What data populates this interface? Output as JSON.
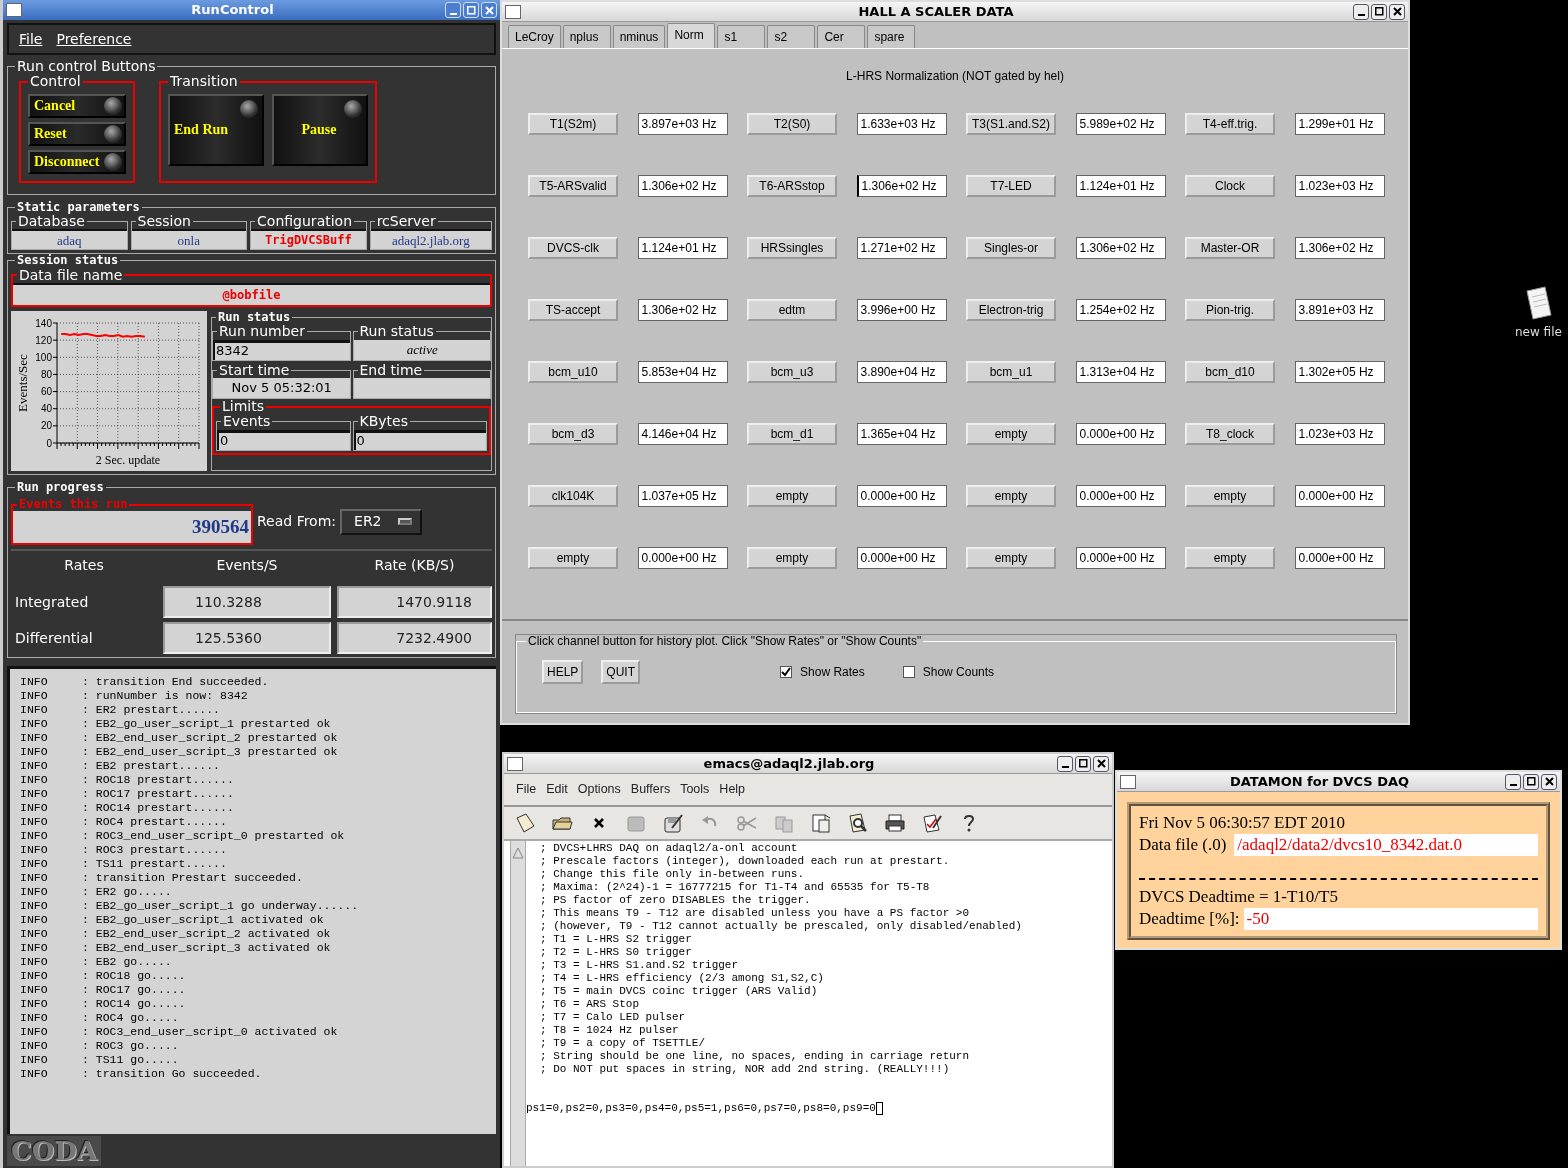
{
  "runcontrol": {
    "title": "RunControl",
    "menu": [
      "File",
      "Preference"
    ],
    "buttons_group": "Run control Buttons",
    "control": {
      "label": "Control",
      "buttons": [
        "Cancel",
        "Reset",
        "Disconnect"
      ]
    },
    "transition": {
      "label": "Transition",
      "buttons": [
        "End Run",
        "Pause"
      ]
    },
    "static": {
      "label": "Static parameters",
      "fields": [
        {
          "label": "Database",
          "value": "adaq",
          "highlight": false
        },
        {
          "label": "Session",
          "value": "onla",
          "highlight": false
        },
        {
          "label": "Configuration",
          "value": "TrigDVCSBuff",
          "highlight": true
        },
        {
          "label": "rcServer",
          "value": "adaql2.jlab.org",
          "highlight": false
        }
      ]
    },
    "session": {
      "label": "Session status",
      "data_file_label": "Data file name",
      "data_file": "@bobfile"
    },
    "chart_data": {
      "type": "line",
      "xlabel": "2 Sec. update",
      "ylabel": "Events/Sec",
      "ylim": [
        0,
        140
      ],
      "grid": true,
      "yticks": [
        0,
        20,
        40,
        60,
        80,
        100,
        120,
        140
      ],
      "categories": [
        null,
        null,
        null,
        null,
        null,
        null,
        null,
        null,
        null,
        null,
        null,
        null,
        null,
        null,
        null,
        null,
        null,
        null,
        null,
        null
      ],
      "series": [
        {
          "color": "#ff0000",
          "values": [
            127,
            127,
            126,
            127,
            126,
            127,
            127,
            126,
            125,
            125,
            126,
            125,
            125,
            126,
            124,
            125,
            124,
            125,
            125,
            124
          ]
        }
      ]
    },
    "run_status": {
      "label": "Run status",
      "fields": [
        {
          "label": "Run number",
          "value": "8342"
        },
        {
          "label": "Run status",
          "value": "active"
        },
        {
          "label": "Start time",
          "value": "Nov 5 05:32:01"
        },
        {
          "label": "End time"
        }
      ]
    },
    "limits": {
      "label": "Limits",
      "fields": [
        {
          "label": "Events",
          "value": "0"
        },
        {
          "label": "KBytes",
          "value": "0"
        }
      ]
    },
    "progress": {
      "label": "Run progress",
      "events_label": "Events this run",
      "events": "390564",
      "read_from_label": "Read From:",
      "read_from": "ER2"
    },
    "rates": {
      "columns": [
        "Rates",
        "Events/S",
        "Rate (KB/S)"
      ],
      "rows": [
        {
          "label": "Integrated",
          "values": [
            "110.3288",
            "1470.9118"
          ]
        },
        {
          "label": "Differential",
          "values": [
            "125.5360",
            "7232.4900"
          ]
        }
      ]
    },
    "log": [
      {
        "level": "INFO",
        "text": ": transition End succeeded."
      },
      {
        "level": "INFO",
        "text": ": runNumber is now: 8342"
      },
      {
        "level": "INFO",
        "text": ": ER2 prestart......"
      },
      {
        "level": "INFO",
        "text": ": EB2_go_user_script_1 prestarted ok"
      },
      {
        "level": "INFO",
        "text": ": EB2_end_user_script_2 prestarted ok"
      },
      {
        "level": "INFO",
        "text": ": EB2_end_user_script_3 prestarted ok"
      },
      {
        "level": "INFO",
        "text": ": EB2 prestart......"
      },
      {
        "level": "INFO",
        "text": ": ROC18 prestart......"
      },
      {
        "level": "INFO",
        "text": ": ROC17 prestart......"
      },
      {
        "level": "INFO",
        "text": ": ROC14 prestart......"
      },
      {
        "level": "INFO",
        "text": ": ROC4 prestart......"
      },
      {
        "level": "INFO",
        "text": ": ROC3_end_user_script_0 prestarted ok"
      },
      {
        "level": "INFO",
        "text": ": ROC3 prestart......"
      },
      {
        "level": "INFO",
        "text": ": TS11 prestart......"
      },
      {
        "level": "INFO",
        "text": ": transition Prestart succeeded."
      },
      {
        "level": "INFO",
        "text": ": ER2 go....."
      },
      {
        "level": "INFO",
        "text": ": EB2_go_user_script_1 go underway......"
      },
      {
        "level": "INFO",
        "text": ": EB2_go_user_script_1 activated ok"
      },
      {
        "level": "INFO",
        "text": ": EB2_end_user_script_2 activated ok"
      },
      {
        "level": "INFO",
        "text": ": EB2_end_user_script_3 activated ok"
      },
      {
        "level": "INFO",
        "text": ": EB2 go....."
      },
      {
        "level": "INFO",
        "text": ": ROC18 go....."
      },
      {
        "level": "INFO",
        "text": ": ROC17 go....."
      },
      {
        "level": "INFO",
        "text": ": ROC14 go....."
      },
      {
        "level": "INFO",
        "text": ": ROC4 go....."
      },
      {
        "level": "INFO",
        "text": ": ROC3_end_user_script_0 activated ok"
      },
      {
        "level": "INFO",
        "text": ": ROC3 go....."
      },
      {
        "level": "INFO",
        "text": ": TS11 go....."
      },
      {
        "level": "INFO",
        "text": ": transition Go succeeded."
      }
    ],
    "logo": "CODA"
  },
  "scaler": {
    "title": "HALL  A  SCALER  DATA",
    "tabs": [
      {
        "label": "LeCroy",
        "selected": false
      },
      {
        "label": "nplus",
        "selected": false
      },
      {
        "label": "nminus",
        "selected": false
      },
      {
        "label": "Norm",
        "selected": true
      },
      {
        "label": "s1",
        "selected": false
      },
      {
        "label": "s2",
        "selected": false
      },
      {
        "label": "Cer",
        "selected": false
      },
      {
        "label": "spare",
        "selected": false
      }
    ],
    "heading": "L-HRS Normalization (NOT gated by hel)",
    "channels": [
      {
        "name": "T1(S2m)",
        "rate": "3.897e+03 Hz"
      },
      {
        "name": "T2(S0)",
        "rate": "1.633e+03 Hz"
      },
      {
        "name": "T3(S1.and.S2)",
        "rate": "5.989e+02 Hz"
      },
      {
        "name": "T4-eff.trig.",
        "rate": "1.299e+01 Hz"
      },
      {
        "name": "T5-ARSvalid",
        "rate": "1.306e+02 Hz"
      },
      {
        "name": "T6-ARSstop",
        "rate": "1.306e+02 Hz",
        "focused": true
      },
      {
        "name": "T7-LED",
        "rate": "1.124e+01 Hz"
      },
      {
        "name": "Clock",
        "rate": "1.023e+03 Hz"
      },
      {
        "name": "DVCS-clk",
        "rate": "1.124e+01 Hz"
      },
      {
        "name": "HRSsingles",
        "rate": "1.271e+02 Hz"
      },
      {
        "name": "Singles-or",
        "rate": "1.306e+02 Hz"
      },
      {
        "name": "Master-OR",
        "rate": "1.306e+02 Hz"
      },
      {
        "name": "TS-accept",
        "rate": "1.306e+02 Hz"
      },
      {
        "name": "edtm",
        "rate": "3.996e+00 Hz"
      },
      {
        "name": "Electron-trig",
        "rate": "1.254e+02 Hz"
      },
      {
        "name": "Pion-trig.",
        "rate": "3.891e+03 Hz"
      },
      {
        "name": "bcm_u10",
        "rate": "5.853e+04 Hz"
      },
      {
        "name": "bcm_u3",
        "rate": "3.890e+04 Hz"
      },
      {
        "name": "bcm_u1",
        "rate": "1.313e+04 Hz"
      },
      {
        "name": "bcm_d10",
        "rate": "1.302e+05 Hz"
      },
      {
        "name": "bcm_d3",
        "rate": "4.146e+04 Hz"
      },
      {
        "name": "bcm_d1",
        "rate": "1.365e+04 Hz"
      },
      {
        "name": "empty",
        "rate": "0.000e+00 Hz"
      },
      {
        "name": "T8_clock",
        "rate": "1.023e+03 Hz"
      },
      {
        "name": "clk104K",
        "rate": "1.037e+05 Hz"
      },
      {
        "name": "empty",
        "rate": "0.000e+00 Hz"
      },
      {
        "name": "empty",
        "rate": "0.000e+00 Hz"
      },
      {
        "name": "empty",
        "rate": "0.000e+00 Hz"
      },
      {
        "name": "empty",
        "rate": "0.000e+00 Hz"
      },
      {
        "name": "empty",
        "rate": "0.000e+00 Hz"
      },
      {
        "name": "empty",
        "rate": "0.000e+00 Hz"
      },
      {
        "name": "empty",
        "rate": "0.000e+00 Hz"
      }
    ],
    "hint": "Click channel button for history plot.  Click \"Show Rates\" or \"Show Counts\"",
    "buttons": [
      "HELP",
      "QUIT"
    ],
    "options": [
      {
        "label": "Show Rates",
        "checked": true
      },
      {
        "label": "Show Counts",
        "checked": false
      }
    ]
  },
  "emacs": {
    "title": "emacs@adaql2.jlab.org",
    "menu": [
      "File",
      "Edit",
      "Options",
      "Buffers",
      "Tools",
      "Help"
    ],
    "lines": [
      "; DVCS+LHRS DAQ on adaql2/a-onl account",
      "; Prescale factors (integer), downloaded each run at prestart.",
      "; Change this file only in-between runs.",
      "; Maxima: (2^24)-1 = 16777215 for T1-T4 and 65535 for T5-T8",
      "; PS factor of zero DISABLES the trigger.",
      "; This means T9 - T12 are disabled unless you have a PS factor >0",
      "; (however, T9 - T12 cannot actually be prescaled, only disabled/enabled)",
      "; T1 = L-HRS S2 trigger",
      "; T2 = L-HRS S0 trigger",
      "; T3 = L-HRS S1.and.S2 trigger",
      "; T4 = L-HRS efficiency (2/3 among S1,S2,C)",
      "; T5 = main DVCS coinc trigger (ARS Valid)",
      "; T6 = ARS Stop",
      "; T7 = Calo LED pulser",
      "; T8 = 1024 Hz pulser",
      "; T9 = a copy of TSETTLE/",
      "; String should be one line, no spaces, ending in carriage return",
      "; Do NOT put spaces in string, NOR add 2nd string. (REALLY!!!)"
    ],
    "value": "ps1=0,ps2=0,ps3=0,ps4=0,ps5=1,ps6=0,ps7=0,ps8=0,ps9=0"
  },
  "datamon": {
    "title": "DATAMON  for DVCS DAQ",
    "date": "Fri Nov  5 06:30:57 EDT 2010",
    "file_label": "Data file (.0)",
    "file": "/adaql2/data2/dvcs10_8342.dat.0",
    "formula": "DVCS Deadtime = 1-T10/T5",
    "deadtime_label": "Deadtime [%]:",
    "deadtime": "-50"
  },
  "desktop": {
    "icons": [
      {
        "label": "new file"
      }
    ]
  }
}
